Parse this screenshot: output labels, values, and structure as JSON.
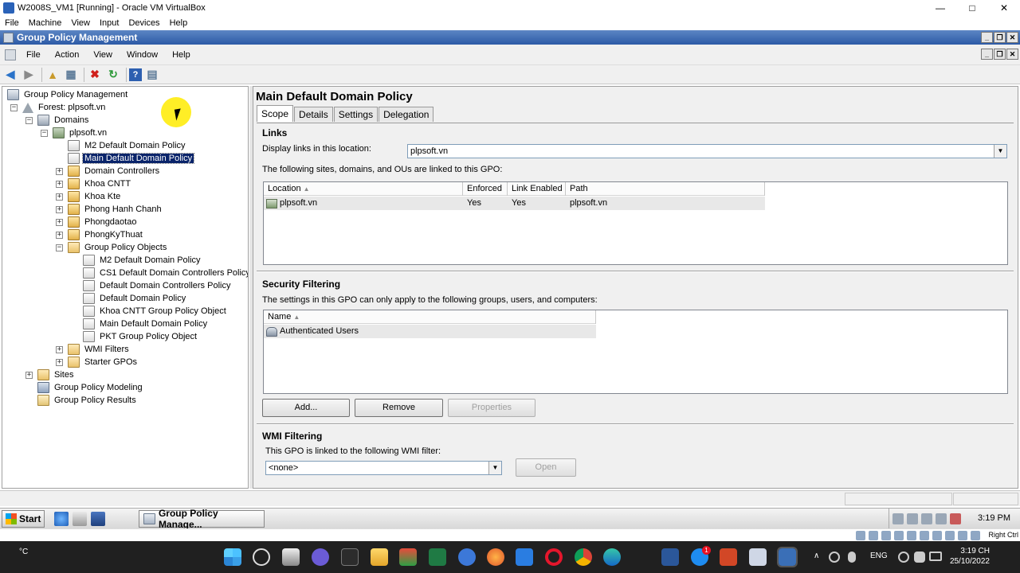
{
  "host_window": {
    "title": "W2008S_VM1 [Running] - Oracle VM VirtualBox",
    "menu": [
      "File",
      "Machine",
      "View",
      "Input",
      "Devices",
      "Help"
    ],
    "controls": {
      "minimize": "—",
      "maximize": "□",
      "close": "✕"
    }
  },
  "gpm_window": {
    "title": "Group Policy Management",
    "controls": {
      "minimize": "_",
      "restore": "❐",
      "close": "✕"
    },
    "menu": [
      "File",
      "Action",
      "View",
      "Window",
      "Help"
    ],
    "toolbar_icons": [
      "back-arrow-icon",
      "forward-arrow-icon",
      "up-folder-icon",
      "show-hide-tree-icon",
      "delete-icon",
      "refresh-icon",
      "help-icon",
      "properties-icon"
    ]
  },
  "tree": {
    "nodes": [
      {
        "label": "Group Policy Management",
        "icon": "gpm",
        "expander": ""
      },
      {
        "label": "Forest: plpsoft.vn",
        "icon": "forest",
        "expander": "−"
      },
      {
        "label": "Domains",
        "icon": "domains",
        "expander": "−"
      },
      {
        "label": "plpsoft.vn",
        "icon": "domain",
        "expander": "−"
      },
      {
        "label": "M2 Default Domain Policy",
        "icon": "link",
        "expander": ""
      },
      {
        "label": "Main Default Domain Policy",
        "icon": "link",
        "expander": "",
        "selected": true
      },
      {
        "label": "Domain Controllers",
        "icon": "ou-info",
        "expander": "+"
      },
      {
        "label": "Khoa CNTT",
        "icon": "ou",
        "expander": "+"
      },
      {
        "label": "Khoa Kte",
        "icon": "ou",
        "expander": "+"
      },
      {
        "label": "Phong Hanh Chanh",
        "icon": "ou",
        "expander": "+"
      },
      {
        "label": "Phongdaotao",
        "icon": "ou",
        "expander": "+"
      },
      {
        "label": "PhongKyThuat",
        "icon": "ou-info",
        "expander": "+"
      },
      {
        "label": "Group Policy Objects",
        "icon": "folder",
        "expander": "−"
      },
      {
        "label": "M2 Default Domain Policy",
        "icon": "gpo",
        "expander": ""
      },
      {
        "label": "CS1 Default Domain Controllers Policy",
        "icon": "gpo",
        "expander": ""
      },
      {
        "label": "Default Domain Controllers Policy",
        "icon": "gpo",
        "expander": ""
      },
      {
        "label": "Default Domain Policy",
        "icon": "gpo",
        "expander": ""
      },
      {
        "label": "Khoa CNTT Group Policy Object",
        "icon": "gpo",
        "expander": ""
      },
      {
        "label": "Main Default Domain Policy",
        "icon": "gpo",
        "expander": ""
      },
      {
        "label": "PKT Group Policy Object",
        "icon": "gpo",
        "expander": ""
      },
      {
        "label": "WMI Filters",
        "icon": "folder",
        "expander": "+"
      },
      {
        "label": "Starter GPOs",
        "icon": "folder",
        "expander": "+"
      },
      {
        "label": "Sites",
        "icon": "sites",
        "expander": "+"
      },
      {
        "label": "Group Policy Modeling",
        "icon": "model",
        "expander": ""
      },
      {
        "label": "Group Policy Results",
        "icon": "results",
        "expander": ""
      }
    ]
  },
  "details": {
    "title": "Main Default Domain Policy",
    "tabs": [
      "Scope",
      "Details",
      "Settings",
      "Delegation"
    ],
    "active_tab": "Scope",
    "links": {
      "heading": "Links",
      "display_label": "Display links in this location:",
      "display_value": "plpsoft.vn",
      "linked_text": "The following sites, domains, and OUs are linked to this GPO:",
      "columns": [
        "Location",
        "Enforced",
        "Link Enabled",
        "Path"
      ],
      "rows": [
        [
          "plpsoft.vn",
          "Yes",
          "Yes",
          "plpsoft.vn"
        ]
      ]
    },
    "security": {
      "heading": "Security Filtering",
      "text": "The settings in this GPO can only apply to the following groups, users, and computers:",
      "columns": [
        "Name"
      ],
      "rows": [
        [
          "Authenticated Users"
        ]
      ],
      "buttons": {
        "add": "Add...",
        "remove": "Remove",
        "properties": "Properties"
      }
    },
    "wmi": {
      "heading": "WMI Filtering",
      "text": "This GPO is linked to the following WMI filter:",
      "value": "<none>",
      "open_button": "Open"
    }
  },
  "guest_taskbar": {
    "start": "Start",
    "task": "Group Policy Manage...",
    "clock": "3:19 PM"
  },
  "vb_status": {
    "host_key": "Right Ctrl"
  },
  "host_taskbar": {
    "weather": "°C",
    "language": "ENG",
    "time": "3:19 CH",
    "date": "25/10/2022",
    "chevron": "∧"
  },
  "colors": {
    "selection": "#0a246a",
    "gpm_title": "#2c5aa6",
    "host_taskbar": "#202020"
  }
}
